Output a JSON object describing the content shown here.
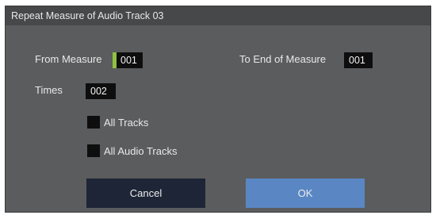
{
  "dialog": {
    "title": "Repeat Measure of Audio Track 03",
    "from_measure": {
      "label": "From Measure",
      "value": "001"
    },
    "to_end_of_measure": {
      "label": "To End of Measure",
      "value": "001"
    },
    "times": {
      "label": "Times",
      "value": "002"
    },
    "all_tracks": {
      "label": "All Tracks",
      "checked": false
    },
    "all_audio_tracks": {
      "label": "All Audio Tracks",
      "checked": false
    },
    "cancel_label": "Cancel",
    "ok_label": "OK"
  },
  "colors": {
    "dialog_bg": "#5b5c5e",
    "titlebar_bg": "#47484a",
    "field_bg": "#0e0e0e",
    "focus_accent": "#8fc23f",
    "cancel_bg": "#1d2536",
    "ok_bg": "#5a87c4"
  }
}
